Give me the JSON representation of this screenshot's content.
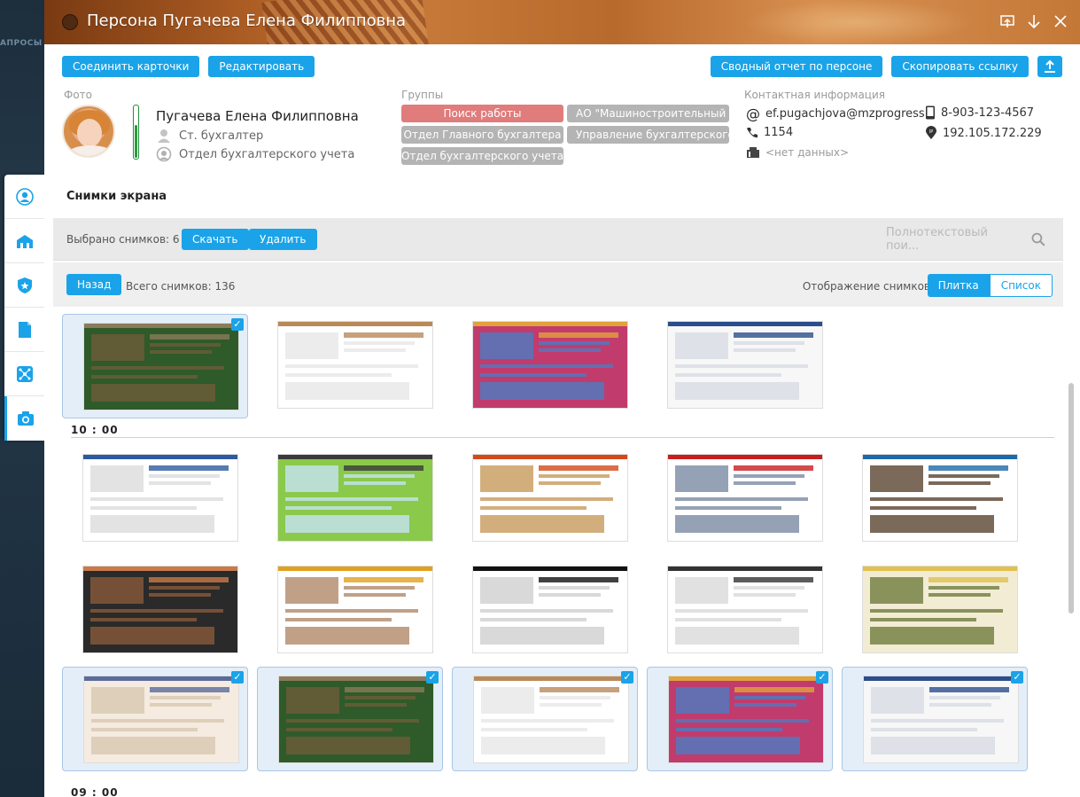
{
  "background": {
    "label": "АПРОСЫ"
  },
  "window": {
    "title": "Персона Пугачева Елена Филипповна",
    "icons": [
      "pin-window-icon",
      "minimize-icon",
      "close-icon"
    ]
  },
  "toolbar": {
    "merge_label": "Соединить карточки",
    "edit_label": "Редактировать",
    "report_label": "Сводный отчет по персоне",
    "copy_link_label": "Скопировать ссылку"
  },
  "photo": {
    "label": "Фото",
    "name": "Пугачева Елена Филипповна",
    "position": "Ст. бухгалтер",
    "department": "Отдел бухгалтерского учета",
    "status_level": 0.62
  },
  "groups": {
    "label": "Группы",
    "items": [
      {
        "label": "Поиск работы",
        "color": "#e07c7c"
      },
      {
        "label": "АО \"Машиностроительный з...",
        "color": "#b4b4b4"
      },
      {
        "label": "Отдел Главного бухгалтера",
        "color": "#b4b4b4"
      },
      {
        "label": "Управление бухгалтерского ...",
        "color": "#b4b4b4"
      },
      {
        "label": "Отдел бухгалтерского учета",
        "color": "#b4b4b4"
      }
    ]
  },
  "contacts": {
    "label": "Контактная информация",
    "email": "ef.pugachjova@mzprogress...",
    "phone_ext": "1154",
    "no_data": "<нет данных>",
    "mobile": "8-903-123-4567",
    "ip": "192.105.172.229"
  },
  "screenshots": {
    "title": "Снимки экрана",
    "selected_text": "Выбрано снимков: 6",
    "download_label": "Скачать",
    "delete_label": "Удалить",
    "search_placeholder": "Полнотекстовый пои...",
    "back_label": "Назад",
    "total_text": "Всего снимков: 136",
    "mode_label": "Отображение снимков",
    "mode_tile": "Плитка",
    "mode_list": "Список",
    "groups": [
      {
        "time": "10 : 00"
      },
      {
        "time": "09 : 00"
      }
    ]
  },
  "colors": {
    "accent": "#1aa3e8",
    "chip_red": "#e07c7c",
    "chip_gray": "#b4b4b4",
    "status_green": "#2a9d3a"
  }
}
